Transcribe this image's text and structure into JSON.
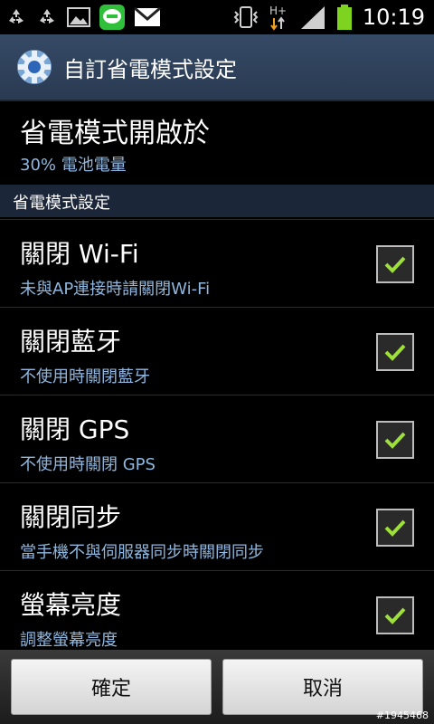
{
  "status_bar": {
    "time": "10:19"
  },
  "header": {
    "title": "自訂省電模式設定"
  },
  "power_saving_on": {
    "title": "省電模式開啟於",
    "value": "30% 電池電量"
  },
  "section": {
    "title": "省電模式設定"
  },
  "items": [
    {
      "title": "關閉 Wi-Fi",
      "subtitle": "未與AP連接時請關閉Wi-Fi",
      "checked": true
    },
    {
      "title": "關閉藍牙",
      "subtitle": "不使用時關閉藍牙",
      "checked": true
    },
    {
      "title": "關閉 GPS",
      "subtitle": "不使用時關閉 GPS",
      "checked": true
    },
    {
      "title": "關閉同步",
      "subtitle": "當手機不與伺服器同步時關閉同步",
      "checked": true
    },
    {
      "title": "螢幕亮度",
      "subtitle": "調整螢幕亮度",
      "checked": true
    }
  ],
  "buttons": {
    "confirm": "確定",
    "cancel": "取消"
  },
  "watermark": "#1945468",
  "colors": {
    "accent_blue": "#8fb7df",
    "check_green": "#9ee03a"
  }
}
